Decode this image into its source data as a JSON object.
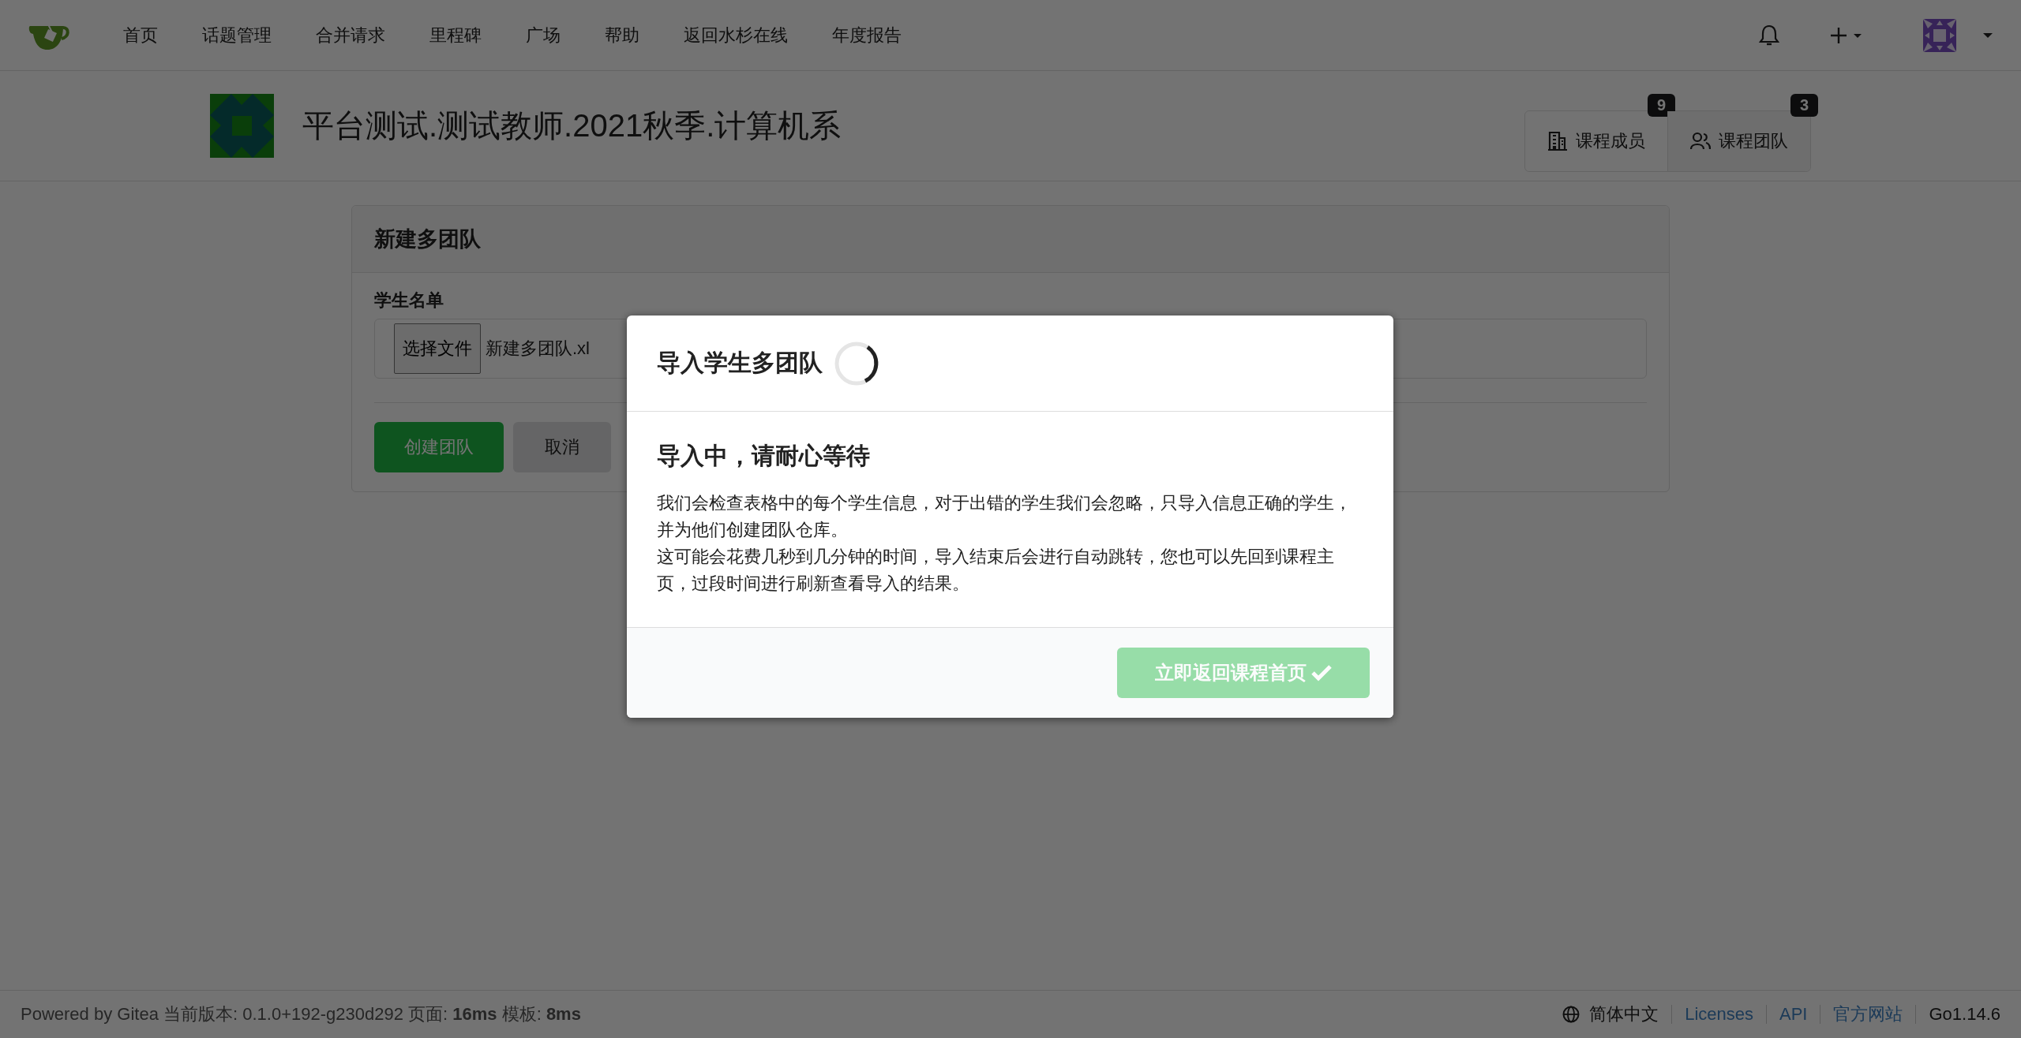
{
  "navbar": {
    "items": [
      "首页",
      "话题管理",
      "合并请求",
      "里程碑",
      "广场",
      "帮助",
      "返回水杉在线",
      "年度报告"
    ]
  },
  "header": {
    "title": "平台测试.测试教师.2021秋季.计算机系",
    "buttons": [
      {
        "label": "课程成员",
        "count": "9",
        "kind": "members"
      },
      {
        "label": "课程团队",
        "count": "3",
        "kind": "teams"
      }
    ]
  },
  "form": {
    "title": "新建多团队",
    "field_label": "学生名单",
    "file_button": "选择文件",
    "file_name": "新建多团队.xl",
    "buttons": [
      {
        "label": "创建团队",
        "kind": "primary"
      },
      {
        "label": "取消",
        "kind": "basic"
      }
    ]
  },
  "modal": {
    "title": "导入学生多团队",
    "loading": true,
    "heading": "导入中，请耐心等待",
    "paragraphs": [
      "我们会检查表格中的每个学生信息，对于出错的学生我们会忽略，只导入信息正确的学生，并为他们创建团队仓库。",
      "这可能会花费几秒到几分钟的时间，导入结束后会进行自动跳转，您也可以先回到课程主页，过段时间进行刷新查看导入的结果。"
    ],
    "button": {
      "label": "立即返回课程首页",
      "disabled": true
    }
  },
  "footer": {
    "powered": "Powered by Gitea 当前版本: 0.1.0+192-g230d292 页面: **16ms** 模板: **8ms**",
    "language": "简体中文",
    "links": [
      "Licenses",
      "API",
      "官方网站"
    ],
    "version": "Go1.14.6"
  }
}
